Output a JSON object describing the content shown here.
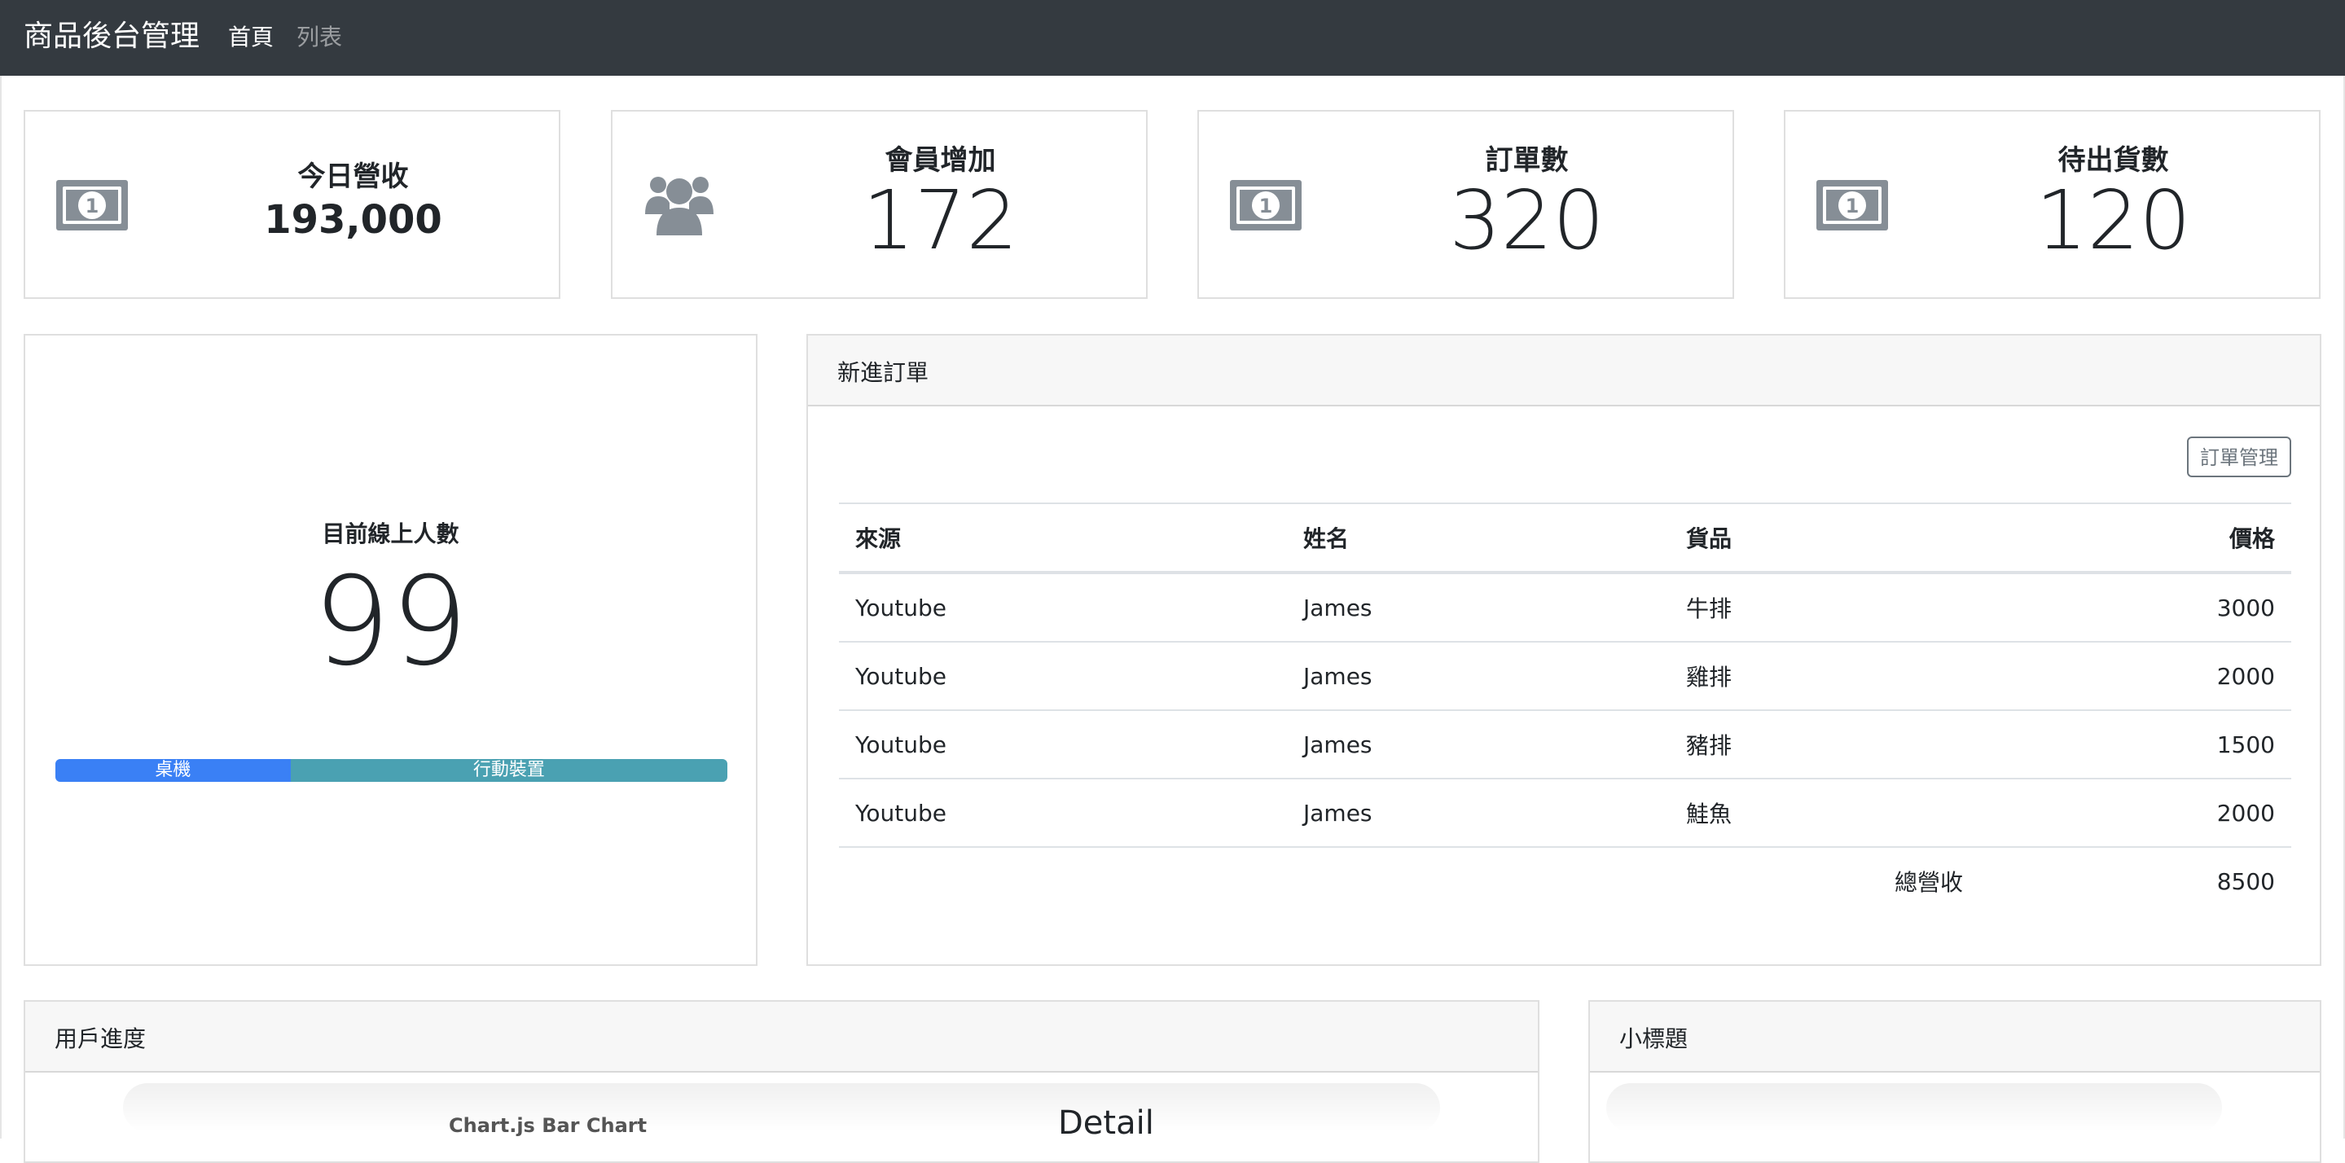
{
  "navbar": {
    "brand": "商品後台管理",
    "links": [
      {
        "label": "首頁",
        "active": true
      },
      {
        "label": "列表",
        "active": false
      }
    ]
  },
  "stats": [
    {
      "label": "今日營收",
      "value": "193,000",
      "icon": "money-bill-icon"
    },
    {
      "label": "會員增加",
      "value": "172",
      "icon": "users-icon"
    },
    {
      "label": "訂單數",
      "value": "320",
      "icon": "money-bill-icon"
    },
    {
      "label": "待出貨數",
      "value": "120",
      "icon": "money-bill-icon"
    }
  ],
  "online": {
    "label": "目前線上人數",
    "value": "99",
    "progress": [
      {
        "label": "桌機",
        "percent": 35,
        "color": "#3a80f5"
      },
      {
        "label": "行動裝置",
        "percent": 65,
        "color": "#4aa1b2"
      }
    ]
  },
  "orders": {
    "header": "新進訂單",
    "manage_button": "訂單管理",
    "columns": [
      "來源",
      "姓名",
      "貨品",
      "價格"
    ],
    "rows": [
      {
        "source": "Youtube",
        "name": "James",
        "item": "牛排",
        "price": "3000"
      },
      {
        "source": "Youtube",
        "name": "James",
        "item": "雞排",
        "price": "2000"
      },
      {
        "source": "Youtube",
        "name": "James",
        "item": "豬排",
        "price": "1500"
      },
      {
        "source": "Youtube",
        "name": "James",
        "item": "鮭魚",
        "price": "2000"
      }
    ],
    "total_label": "總營收",
    "total_value": "8500"
  },
  "user_progress": {
    "header": "用戶進度",
    "chart_caption": "Chart.js Bar Chart",
    "detail_title": "Detail"
  },
  "small_card": {
    "header": "小標題"
  },
  "colors": {
    "navbar": "#343a40",
    "icon": "#868e96",
    "desktop_bar": "#3a80f5",
    "mobile_bar": "#4aa1b2"
  }
}
